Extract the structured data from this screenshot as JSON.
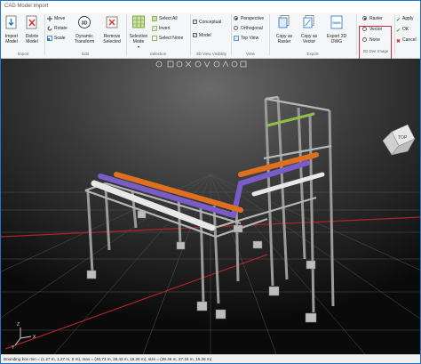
{
  "window": {
    "title": "CAD Model Import"
  },
  "ribbon": {
    "import_group": {
      "label": "Import",
      "import_model": "Import Model",
      "delete_model": "Delete Model"
    },
    "edit_group": {
      "label": "Edit",
      "move": "Move",
      "rotate": "Rotate",
      "scale": "Scale",
      "dynamic_transform": "Dynamic Transform",
      "remove_selected": "Remove Selected"
    },
    "selection_group": {
      "label": "Selection",
      "selection_mode": "Selection Mode",
      "select_all": "Select All",
      "invert": "Invert",
      "select_none": "Select None"
    },
    "visibility_group": {
      "label": "3D View Visibility",
      "conceptual": "Conceptual",
      "conceptual_checked": true,
      "model": "Model",
      "model_checked": true
    },
    "view_group": {
      "label": "View",
      "perspective": "Perspective",
      "orthogonal": "Orthogonal",
      "top_view": "Top View",
      "selected": "Perspective"
    },
    "export_group": {
      "label": "Export",
      "copy_raster": "Copy as Raster",
      "copy_vector": "Copy as Vector",
      "export_2d_dwg": "Export 2D DWG"
    },
    "image_group": {
      "label": "2D Dwr Image",
      "raster": "Raster",
      "vector": "Vector",
      "none": "None",
      "selected": "Raster"
    },
    "actions": {
      "apply": "Apply",
      "ok": "OK",
      "cancel": "Cancel"
    }
  },
  "viewport": {
    "cube_label": "TOP",
    "axis_x": "X",
    "axis_y": "Y",
    "axis_z": "Z"
  },
  "status": {
    "text": "Bounding box min = (1.27 m, 1.27 m, 0 m), max = (40.73 m, 28.43 m, 15.26 m), size = (39.46 m, 27.16 m, 15.26 m)"
  },
  "colors": {
    "accent": "#1e75c9",
    "highlight_box": "#e0243a",
    "pipe_orange": "#e0701e",
    "pipe_purple": "#7a5cc8",
    "pipe_white": "#e8e8e8",
    "pipe_green": "#8fbf4a",
    "grid_red": "#b0222a"
  }
}
